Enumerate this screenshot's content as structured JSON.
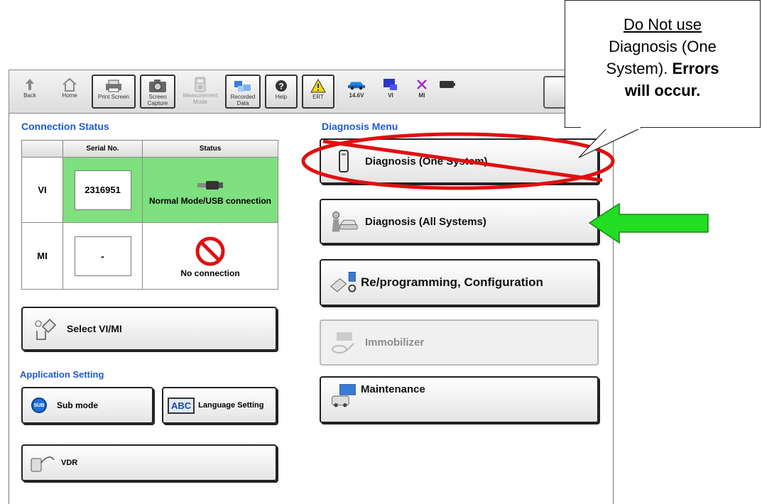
{
  "toolbar": {
    "back": "Back",
    "home": "Home",
    "print_screen": "Print Screen",
    "screen_capture": "Screen Capture",
    "measurement_mode": "Measurement Mode",
    "recorded_data": "Recorded Data",
    "help": "Help",
    "ert": "ERT",
    "voltage": "14.6V",
    "vi": "VI",
    "mi": "MI"
  },
  "connection_status": {
    "title": "Connection Status",
    "col_serial": "Serial No.",
    "col_status": "Status",
    "rows": [
      {
        "name": "VI",
        "serial": "2316951",
        "status": "Normal Mode/USB connection"
      },
      {
        "name": "MI",
        "serial": "-",
        "status": "No connection"
      }
    ],
    "select_button": "Select VI/MI"
  },
  "application_setting": {
    "title": "Application Setting",
    "sub_mode": "Sub mode",
    "sub_icon": "SUB",
    "language_setting": "Language Setting",
    "abc_icon": "ABC",
    "vdr": "VDR"
  },
  "diagnosis_menu": {
    "title": "Diagnosis Menu",
    "items": [
      {
        "label": "Diagnosis (One System)"
      },
      {
        "label": "Diagnosis (All Systems)"
      },
      {
        "label": "Re/programming, Configuration"
      },
      {
        "label": "Immobilizer"
      },
      {
        "label": "Maintenance"
      }
    ]
  },
  "callout": {
    "line1": "Do Not use",
    "line2": "Diagnosis (One",
    "line3": "System).",
    "line3_bold": "Errors",
    "line4_bold": "will occur."
  },
  "colors": {
    "section_heading": "#1f5bd1",
    "ok_green": "#7ee07e",
    "warning_red": "#e01010",
    "arrow_green": "#22dd22"
  }
}
